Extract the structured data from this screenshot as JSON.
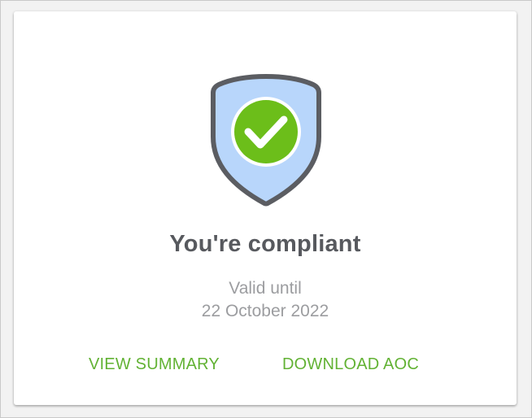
{
  "compliance_card": {
    "status_icon": "shield-check-icon",
    "title": "You're compliant",
    "valid_until_label": "Valid until",
    "valid_until_date": "22 October 2022",
    "actions": {
      "view_summary": "VIEW SUMMARY",
      "download_aoc": "DOWNLOAD AOC"
    },
    "colors": {
      "shield_fill": "#b8d6fb",
      "shield_stroke": "#5b5d62",
      "check_badge": "#6cbe1a",
      "action_text": "#62b234",
      "title_text": "#57595e",
      "muted_text": "#9c9da0"
    }
  }
}
